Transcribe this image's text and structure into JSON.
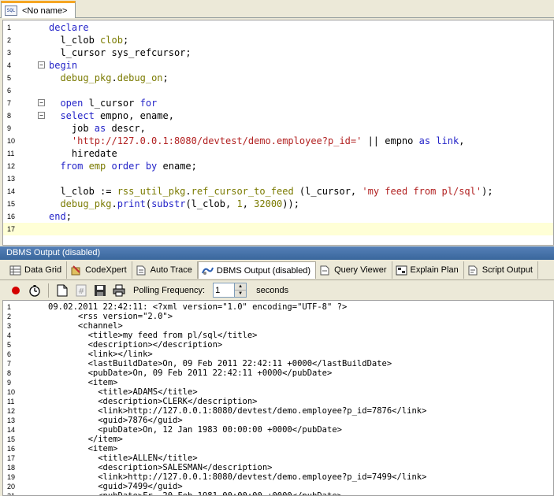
{
  "tab": {
    "label": "<No name>",
    "icon": "sql-file-icon"
  },
  "editor": {
    "lines": [
      {
        "n": "1",
        "fold": "",
        "parts": [
          [
            "kw",
            "declare"
          ]
        ]
      },
      {
        "n": "2",
        "fold": "",
        "parts": [
          [
            "pl",
            "  l_clob "
          ],
          [
            "fn",
            "clob"
          ],
          [
            "pl",
            ";"
          ]
        ]
      },
      {
        "n": "3",
        "fold": "",
        "parts": [
          [
            "pl",
            "  l_cursor sys_refcursor;"
          ]
        ]
      },
      {
        "n": "4",
        "fold": "−",
        "parts": [
          [
            "kw",
            "begin"
          ]
        ]
      },
      {
        "n": "5",
        "fold": "",
        "parts": [
          [
            "fn",
            "  debug_pkg"
          ],
          [
            "pl",
            "."
          ],
          [
            "fn",
            "debug_on"
          ],
          [
            "pl",
            ";"
          ]
        ]
      },
      {
        "n": "6",
        "fold": "",
        "parts": [
          [
            "pl",
            ""
          ]
        ]
      },
      {
        "n": "7",
        "fold": "−",
        "parts": [
          [
            "kw",
            "  open "
          ],
          [
            "pl",
            "l_cursor "
          ],
          [
            "kw",
            "for"
          ]
        ]
      },
      {
        "n": "8",
        "fold": "−",
        "parts": [
          [
            "kw",
            "  select "
          ],
          [
            "pl",
            "empno, ename,"
          ]
        ]
      },
      {
        "n": "9",
        "fold": "",
        "parts": [
          [
            "pl",
            "    job "
          ],
          [
            "kw",
            "as "
          ],
          [
            "pl",
            "descr,"
          ]
        ]
      },
      {
        "n": "10",
        "fold": "",
        "parts": [
          [
            "str",
            "    'http://127.0.0.1:8080/devtest/demo.employee?p_id='"
          ],
          [
            "pl",
            " || empno "
          ],
          [
            "kw",
            "as "
          ],
          [
            "kw",
            "link"
          ],
          [
            "pl",
            ","
          ]
        ]
      },
      {
        "n": "11",
        "fold": "",
        "parts": [
          [
            "pl",
            "    hiredate"
          ]
        ]
      },
      {
        "n": "12",
        "fold": "",
        "parts": [
          [
            "kw",
            "  from "
          ],
          [
            "fn",
            "emp "
          ],
          [
            "kw",
            "order by "
          ],
          [
            "pl",
            "ename;"
          ]
        ]
      },
      {
        "n": "13",
        "fold": "",
        "parts": [
          [
            "pl",
            ""
          ]
        ]
      },
      {
        "n": "14",
        "fold": "",
        "parts": [
          [
            "pl",
            "  l_clob := "
          ],
          [
            "fn",
            "rss_util_pkg"
          ],
          [
            "pl",
            "."
          ],
          [
            "fn",
            "ref_cursor_to_feed"
          ],
          [
            "pl",
            " (l_cursor, "
          ],
          [
            "str",
            "'my feed from pl/sql'"
          ],
          [
            "pl",
            ");"
          ]
        ]
      },
      {
        "n": "15",
        "fold": "",
        "parts": [
          [
            "fn",
            "  debug_pkg"
          ],
          [
            "pl",
            "."
          ],
          [
            "kw",
            "print"
          ],
          [
            "pl",
            "("
          ],
          [
            "kw",
            "substr"
          ],
          [
            "pl",
            "(l_clob, "
          ],
          [
            "fn",
            "1"
          ],
          [
            "pl",
            ", "
          ],
          [
            "fn",
            "32000"
          ],
          [
            "pl",
            "));"
          ]
        ]
      },
      {
        "n": "16",
        "fold": "",
        "parts": [
          [
            "kw",
            "end"
          ],
          [
            "pl",
            ";"
          ]
        ]
      },
      {
        "n": "17",
        "fold": "",
        "parts": [
          [
            "pl",
            ""
          ]
        ]
      }
    ]
  },
  "panel": {
    "title": "DBMS Output (disabled)"
  },
  "output_tabs": [
    {
      "label": "Data Grid",
      "icon": "data-grid-icon",
      "active": false
    },
    {
      "label": "CodeXpert",
      "icon": "codexpert-icon",
      "active": false
    },
    {
      "label": "Auto Trace",
      "icon": "auto-trace-icon",
      "active": false
    },
    {
      "label": "DBMS Output (disabled)",
      "icon": "dbms-output-icon",
      "active": true
    },
    {
      "label": "Query Viewer",
      "icon": "query-viewer-icon",
      "active": false
    },
    {
      "label": "Explain Plan",
      "icon": "explain-plan-icon",
      "active": false
    },
    {
      "label": "Script Output",
      "icon": "script-output-icon",
      "active": false
    }
  ],
  "toolbar": {
    "polling_label": "Polling Frequency:",
    "polling_value": "1",
    "seconds_label": "seconds"
  },
  "output": {
    "lines": [
      {
        "n": "1",
        "text": "09.02.2011 22:42:11: <?xml version=\"1.0\" encoding=\"UTF-8\" ?>"
      },
      {
        "n": "2",
        "text": "      <rss version=\"2.0\">"
      },
      {
        "n": "3",
        "text": "      <channel>"
      },
      {
        "n": "4",
        "text": "        <title>my feed from pl/sql</title>"
      },
      {
        "n": "5",
        "text": "        <description></description>"
      },
      {
        "n": "6",
        "text": "        <link></link>"
      },
      {
        "n": "7",
        "text": "        <lastBuildDate>On, 09 Feb 2011 22:42:11 +0000</lastBuildDate>"
      },
      {
        "n": "8",
        "text": "        <pubDate>On, 09 Feb 2011 22:42:11 +0000</pubDate>"
      },
      {
        "n": "9",
        "text": "        <item>"
      },
      {
        "n": "10",
        "text": "          <title>ADAMS</title>"
      },
      {
        "n": "11",
        "text": "          <description>CLERK</description>"
      },
      {
        "n": "12",
        "text": "          <link>http://127.0.0.1:8080/devtest/demo.employee?p_id=7876</link>"
      },
      {
        "n": "13",
        "text": "          <guid>7876</guid>"
      },
      {
        "n": "14",
        "text": "          <pubDate>On, 12 Jan 1983 00:00:00 +0000</pubDate>"
      },
      {
        "n": "15",
        "text": "        </item>"
      },
      {
        "n": "16",
        "text": "        <item>"
      },
      {
        "n": "17",
        "text": "          <title>ALLEN</title>"
      },
      {
        "n": "18",
        "text": "          <description>SALESMAN</description>"
      },
      {
        "n": "19",
        "text": "          <link>http://127.0.0.1:8080/devtest/demo.employee?p_id=7499</link>"
      },
      {
        "n": "20",
        "text": "          <guid>7499</guid>"
      },
      {
        "n": "21",
        "text": "          <pubDate>Fr, 20 Feb 1981 00:00:00 +0000</pubDate>"
      }
    ]
  }
}
